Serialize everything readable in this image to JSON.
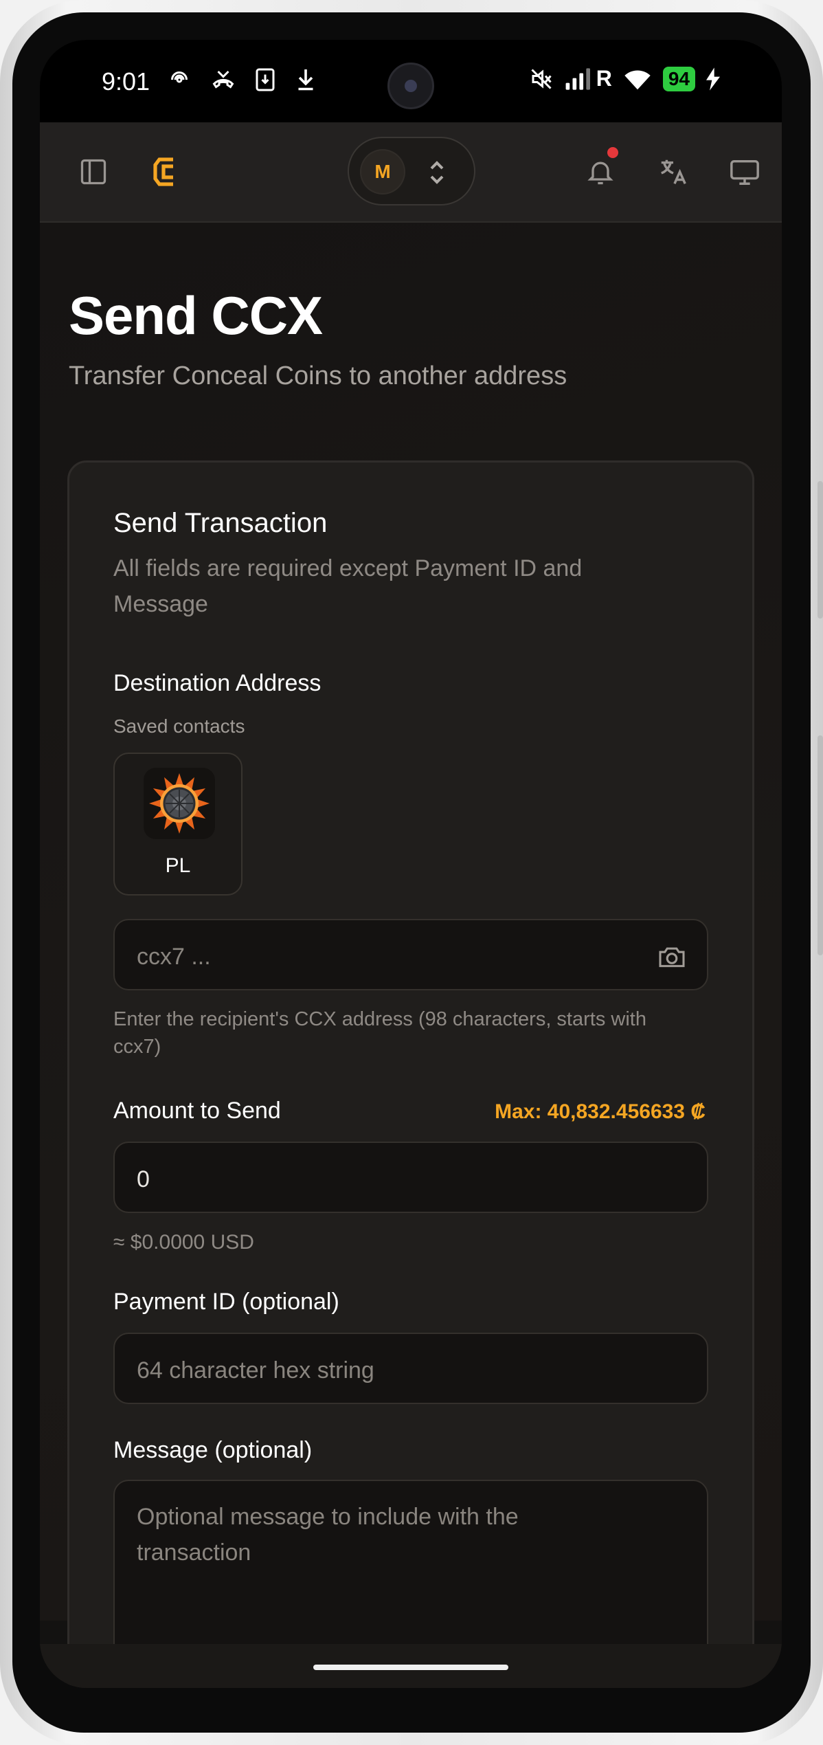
{
  "status_bar": {
    "time": "9:01",
    "left_icons": [
      "hotspot-icon",
      "missed-call-icon",
      "sim-download-icon",
      "download-icon"
    ],
    "right_icons": [
      "mute-icon",
      "signal-icon",
      "roaming-indicator",
      "wifi-icon"
    ],
    "roaming": "R",
    "battery": "94"
  },
  "header": {
    "sidebar_icon": "sidebar-toggle-icon",
    "logo": "C",
    "account_initial": "M",
    "icons": [
      "bell-icon",
      "translate-icon",
      "monitor-icon"
    ],
    "has_notification": true,
    "accent": "#f5a623"
  },
  "page": {
    "title": "Send CCX",
    "subtitle": "Transfer Conceal Coins to another address"
  },
  "form": {
    "card_title": "Send Transaction",
    "card_subtitle": "All fields are required except Payment ID and Message",
    "destination_label": "Destination Address",
    "saved_contacts_label": "Saved contacts",
    "contacts": [
      {
        "name": "PL"
      }
    ],
    "address_placeholder": "ccx7 ...",
    "address_help": "Enter the recipient's CCX address (98 characters, starts with ccx7)",
    "amount_label": "Amount to Send",
    "max_label": "Max: 40,832.456633 ₡",
    "amount_value": "0",
    "usd_estimate": "≈ $0.0000 USD",
    "payment_id_label": "Payment ID (optional)",
    "payment_id_placeholder": "64 character hex string",
    "message_label": "Message (optional)",
    "message_placeholder": "Optional message to include with the transaction"
  }
}
